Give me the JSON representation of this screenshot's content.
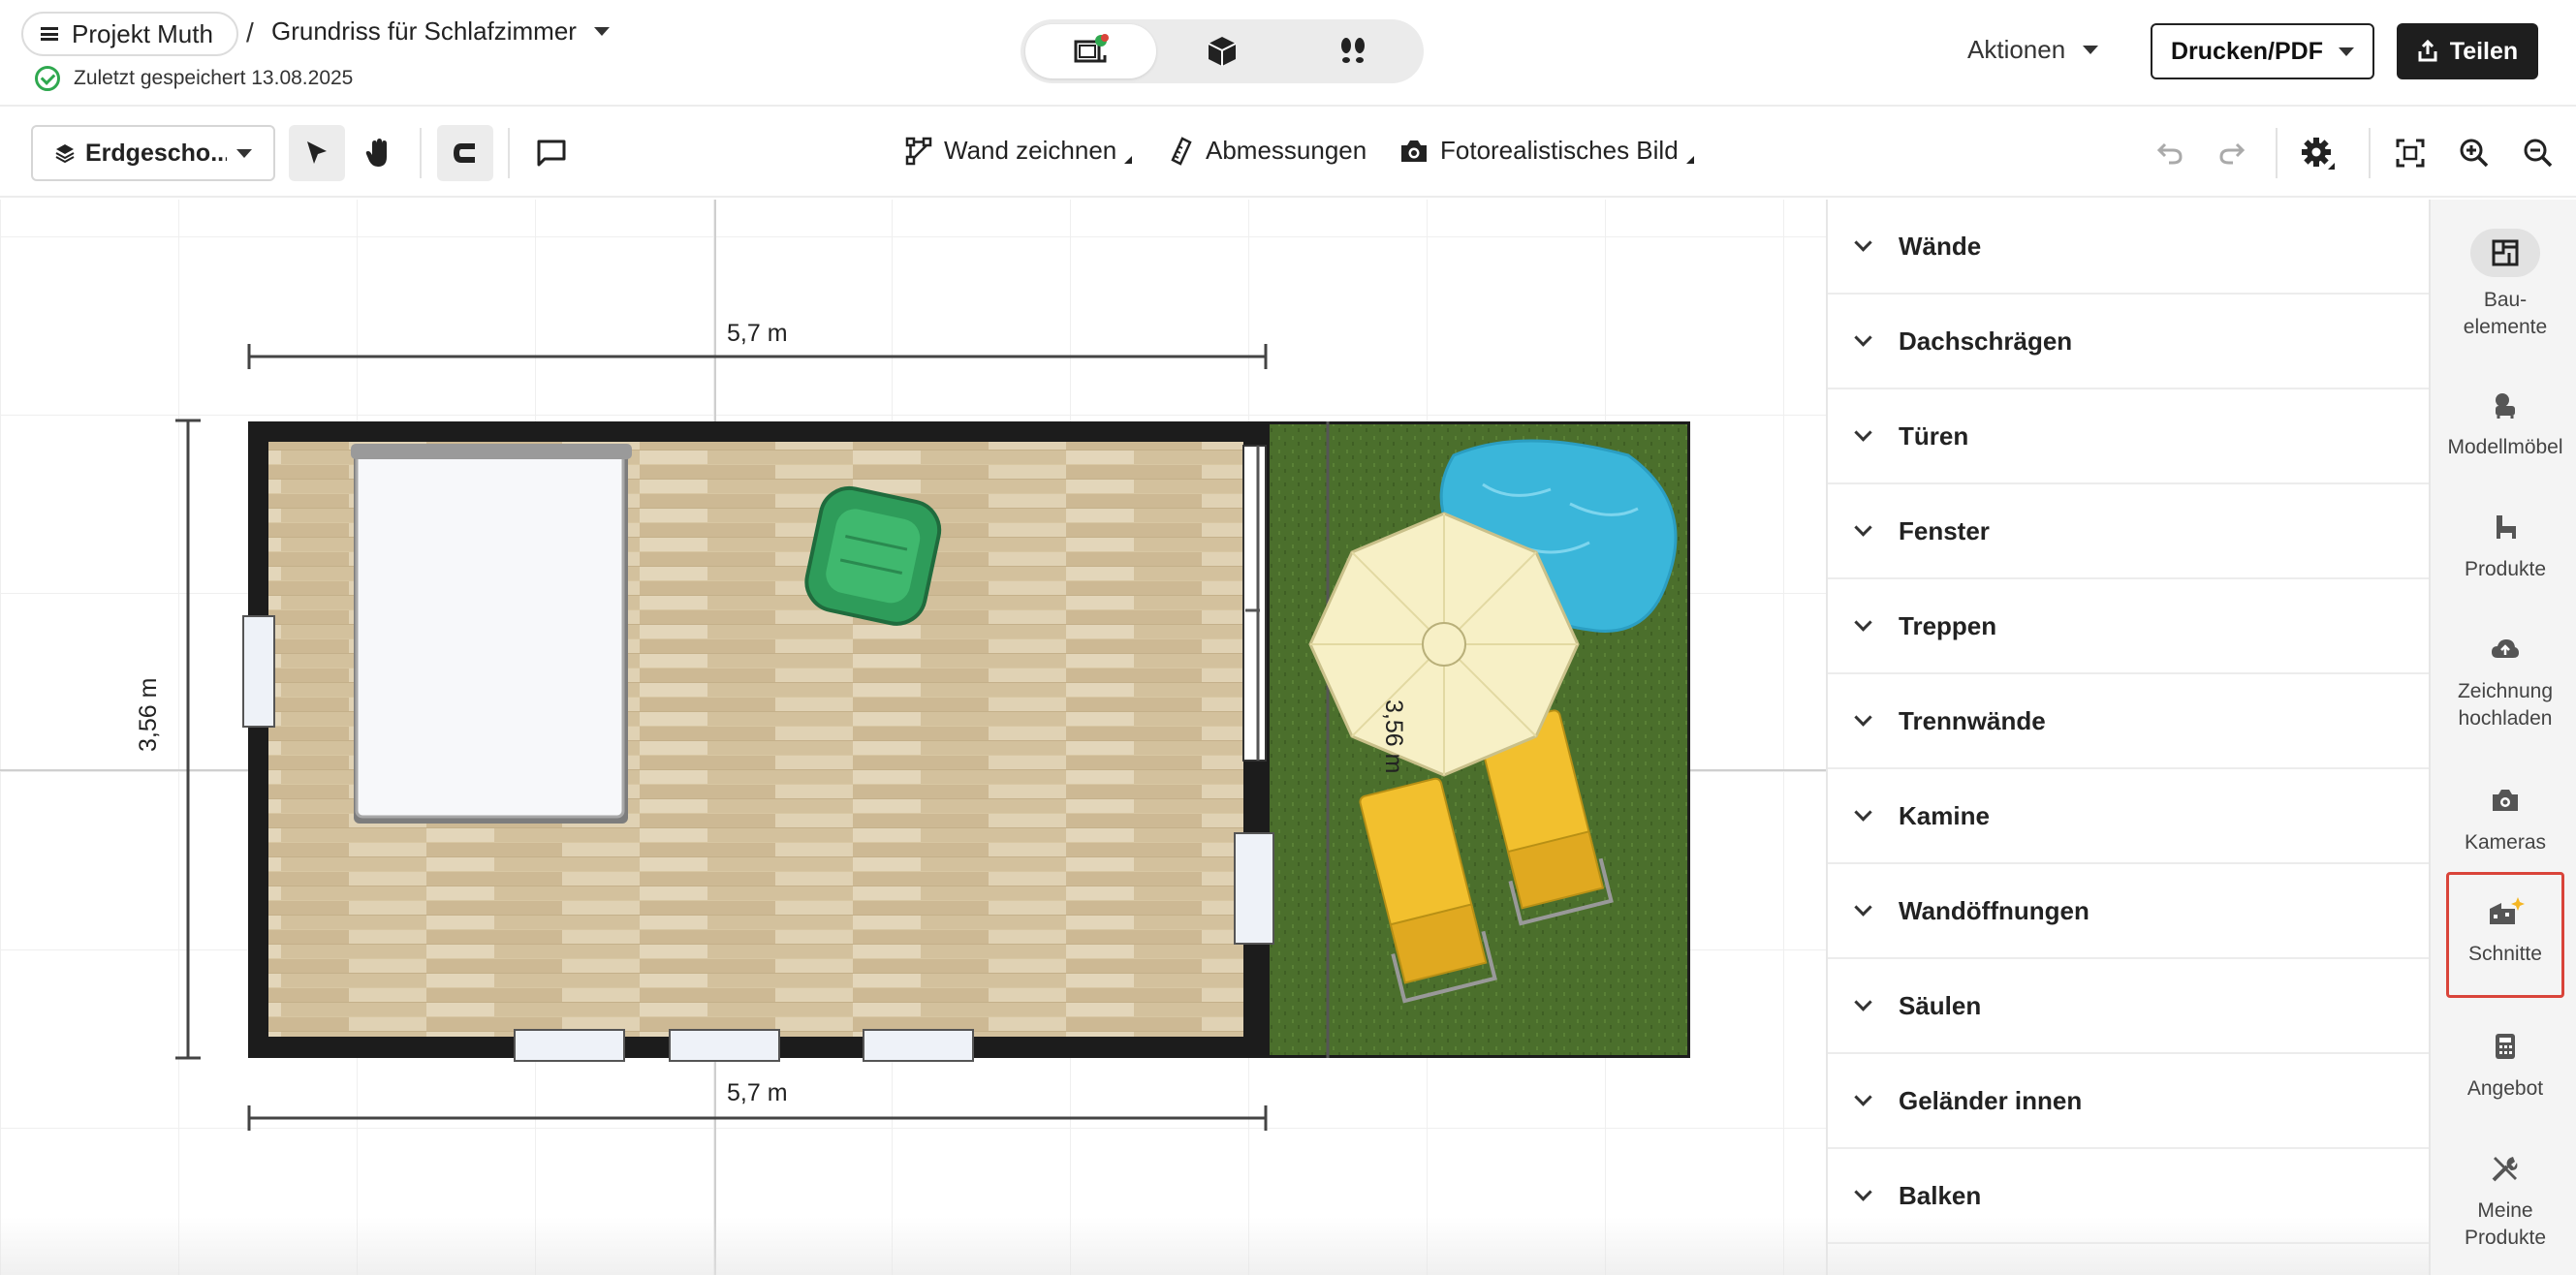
{
  "header": {
    "project_label": "Projekt Muth",
    "breadcrumb_sep": "/",
    "plan_title": "Grundriss für Schlafzimmer",
    "saved_status": "Zuletzt gespeichert 13.08.2025",
    "view_modes": [
      "2D-Ansicht",
      "3D-Ansicht",
      "Rundgang"
    ],
    "actions_label": "Aktionen",
    "print_label": "Drucken/PDF",
    "share_label": "Teilen"
  },
  "toolbar": {
    "floor_label": "Erdgescho...",
    "draw_wall_label": "Wand zeichnen",
    "dimensions_label": "Abmessungen",
    "photo_label": "Fotorealistisches Bild"
  },
  "canvas": {
    "dim_top": "5,7 m",
    "dim_bottom": "5,7 m",
    "dim_left": "3,56 m",
    "dim_right": "3,56 m"
  },
  "categories": [
    "Wände",
    "Dachschrägen",
    "Türen",
    "Fenster",
    "Treppen",
    "Trennwände",
    "Kamine",
    "Wandöffnungen",
    "Säulen",
    "Geländer innen",
    "Balken"
  ],
  "rail": {
    "building": "Bau-elemente",
    "building_l1": "Bau-",
    "building_l2": "elemente",
    "furniture": "Modellmöbel",
    "products": "Produkte",
    "upload_l1": "Zeichnung",
    "upload_l2": "hochladen",
    "cameras": "Kameras",
    "sections": "Schnitte",
    "quote": "Angebot",
    "myproducts_l1": "Meine",
    "myproducts_l2": "Produkte"
  },
  "colors": {
    "accent_dark": "#1e1e1e",
    "saved_green": "#2fa84f",
    "highlight_red": "#d9443a",
    "sparkle_yellow": "#f5b623",
    "wall": "#1c1c1c",
    "floor_wood": "#d9c8a6",
    "lawn": "#4a6e2b",
    "pool": "#3ab6da"
  }
}
